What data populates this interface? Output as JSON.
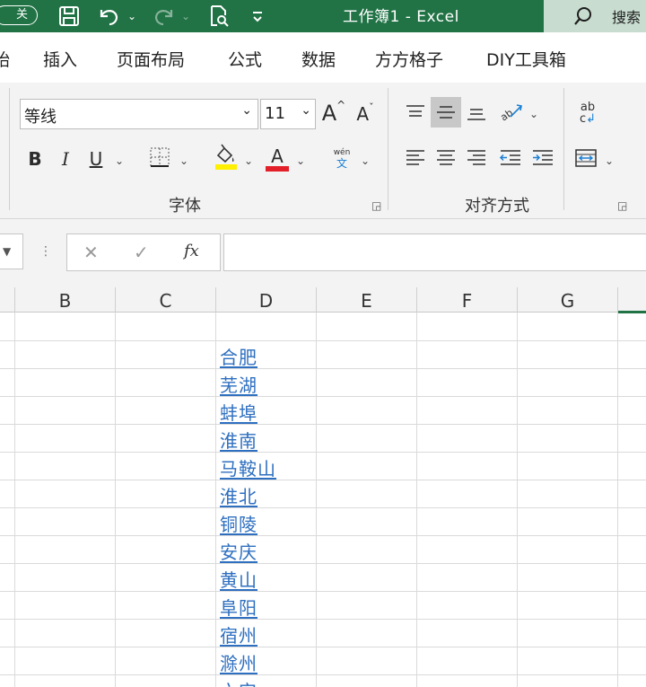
{
  "titlebar": {
    "autosave_label": "关",
    "doc_title": "工作簿1  -  Excel",
    "search_label": "搜索",
    "icons": [
      "save-icon",
      "undo-icon",
      "redo-icon",
      "print-preview-icon",
      "customize-qat-icon",
      "search-icon"
    ]
  },
  "tabs": {
    "home_partial": "始",
    "items": [
      "插入",
      "页面布局",
      "公式",
      "数据",
      "方方格子",
      "DIY工具箱"
    ]
  },
  "ribbon": {
    "font_name": "等线",
    "font_size": "11",
    "grow_font": "A",
    "shrink_font": "A",
    "bold": "B",
    "italic": "I",
    "underline": "U",
    "font_color_letter": "A",
    "phonetic_top": "wén",
    "phonetic_bottom": "文",
    "wrap_text_label": "ab",
    "wrap_text_label2": "c",
    "font_group_label": "字体",
    "align_group_label": "对齐方式",
    "colors": {
      "highlight": "#ffef00",
      "font_color": "#e3202a",
      "accent": "#217346"
    }
  },
  "formula_bar": {
    "cancel": "✕",
    "enter": "✓",
    "fx": "fx"
  },
  "grid": {
    "columns": [
      "B",
      "C",
      "D",
      "E",
      "F",
      "G"
    ],
    "column_d_values": [
      "合肥",
      "芜湖",
      "蚌埠",
      "淮南",
      "马鞍山",
      "淮北",
      "铜陵",
      "安庆",
      "黄山",
      "阜阳",
      "宿州",
      "滁州",
      "六安"
    ]
  }
}
